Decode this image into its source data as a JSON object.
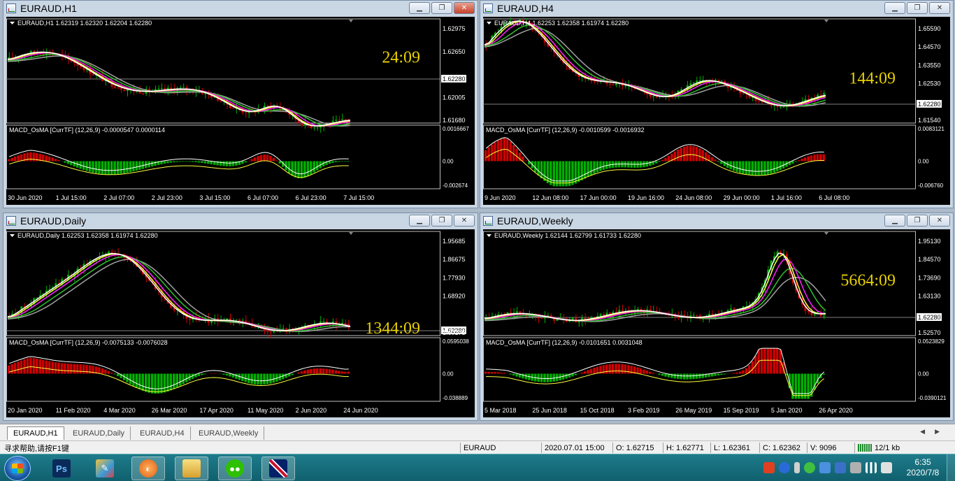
{
  "windows": [
    {
      "id": "h1",
      "title": "EURAUD,H1",
      "close_red": true,
      "info": "EURAUD,H1  1.62319 1.62320 1.62204 1.62280",
      "price_labels": [
        "1.62975",
        "1.62650",
        "1.62280",
        "1.62005",
        "1.61680"
      ],
      "countdown": "24:09",
      "indicator_label": "MACD_OsMA [CurrTF] (12,26,9) -0.0000547 0.0000114",
      "indicator_labels": [
        "0.0016667",
        "0.00",
        "-0.002674"
      ],
      "time_labels": [
        "30 Jun 2020",
        "1 Jul 15:00",
        "2 Jul 07:00",
        "2 Jul 23:00",
        "3 Jul 15:00",
        "6 Jul 07:00",
        "6 Jul 23:00",
        "7 Jul 15:00"
      ]
    },
    {
      "id": "h4",
      "title": "EURAUD,H4",
      "close_red": false,
      "info": "EURAUD,H4  1.62253 1.62358 1.61974 1.62280",
      "price_labels": [
        "1.65590",
        "1.64570",
        "1.63550",
        "1.62530",
        "1.62280",
        "1.61540"
      ],
      "countdown": "144:09",
      "indicator_label": "MACD_OsMA [CurrTF] (12,26,9) -0.0010599 -0.0016932",
      "indicator_labels": [
        "0.0083121",
        "0.00",
        "-0.006760"
      ],
      "time_labels": [
        "9 Jun 2020",
        "12 Jun 08:00",
        "17 Jun 00:00",
        "19 Jun 16:00",
        "24 Jun 08:00",
        "29 Jun 00:00",
        "1 Jul 16:00",
        "6 Jul 08:00"
      ]
    },
    {
      "id": "daily",
      "title": "EURAUD,Daily",
      "close_red": false,
      "info": "EURAUD,Daily  1.62253 1.62358 1.61974 1.62280",
      "price_labels": [
        "1.95685",
        "1.86675",
        "1.77930",
        "1.68920",
        "1.62280",
        "1.60175"
      ],
      "countdown": "1344:09",
      "indicator_label": "MACD_OsMA [CurrTF] (12,26,9) -0.0075133 -0.0076028",
      "indicator_labels": [
        "0.0595038",
        "0.00",
        "-0.038889"
      ],
      "time_labels": [
        "20 Jan 2020",
        "11 Feb 2020",
        "4 Mar 2020",
        "26 Mar 2020",
        "17 Apr 2020",
        "11 May 2020",
        "2 Jun 2020",
        "24 Jun 2020"
      ]
    },
    {
      "id": "weekly",
      "title": "EURAUD,Weekly",
      "close_red": false,
      "info": "EURAUD,Weekly  1.62144 1.62799 1.61733 1.62280",
      "price_labels": [
        "1.95130",
        "1.84570",
        "1.73690",
        "1.63130",
        "1.62280",
        "1.52570"
      ],
      "countdown": "5664:09",
      "indicator_label": "MACD_OsMA [CurrTF] (12,26,9) -0.0101651 0.0031048",
      "indicator_labels": [
        "0.0523829",
        "0.00",
        "-0.0390121"
      ],
      "time_labels": [
        "5 Mar 2018",
        "25 Jun 2018",
        "15 Oct 2018",
        "3 Feb 2019",
        "26 May 2019",
        "15 Sep 2019",
        "5 Jan 2020",
        "26 Apr 2020"
      ]
    }
  ],
  "tabs": [
    "EURAUD,H1",
    "EURAUD,Daily",
    "EURAUD,H4",
    "EURAUD,Weekly"
  ],
  "active_tab": 0,
  "status": {
    "help": "寻求帮助,请按F1键",
    "symbol": "EURAUD",
    "datetime": "2020.07.01 15:00",
    "open": "O: 1.62715",
    "high": "H: 1.62771",
    "low": "L: 1.62361",
    "close": "C: 1.62362",
    "volume": "V: 9096",
    "traffic": "12/1 kb"
  },
  "taskbar": {
    "time": "6:35",
    "date": "2020/7/8"
  },
  "colors": {
    "bull": "#00b000",
    "bear": "#d00000",
    "countdown": "#e8d000",
    "ma_white": "#ffffff",
    "ma_yellow": "#ffff40",
    "ma_magenta": "#ff20ff",
    "ma_green": "#30c030",
    "ma_gray": "#a0a0a0"
  }
}
